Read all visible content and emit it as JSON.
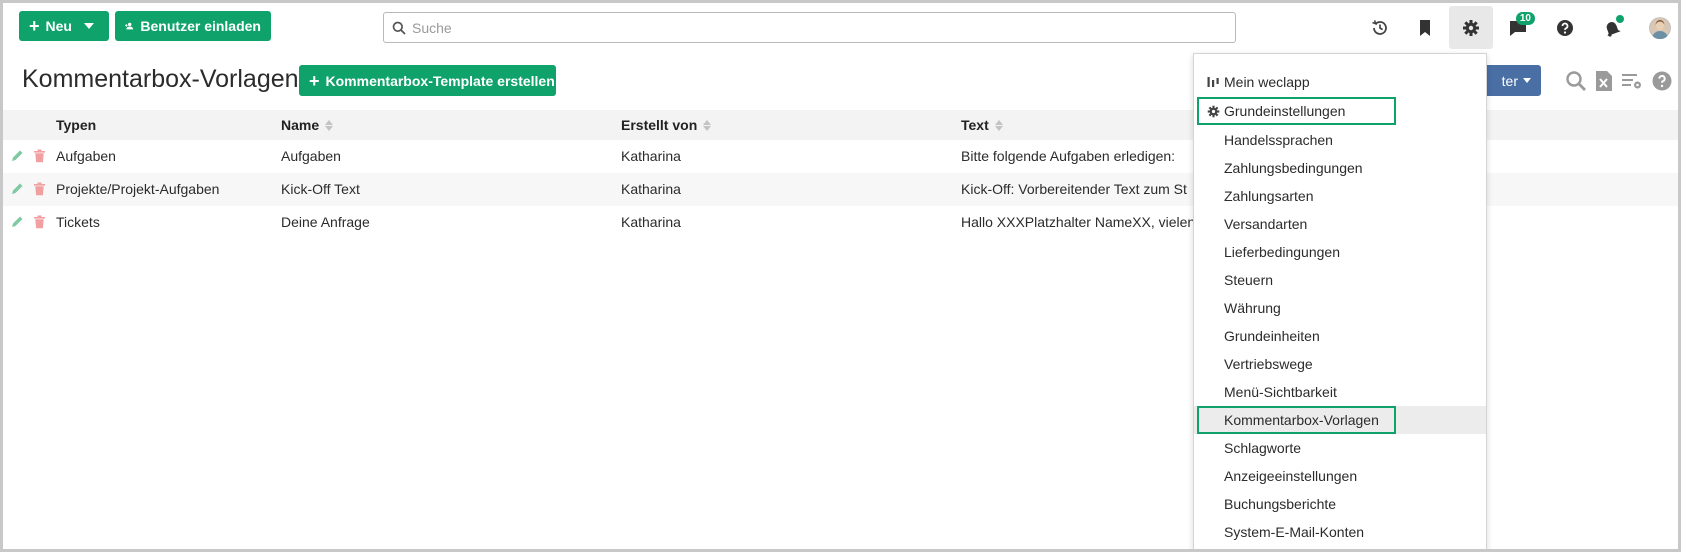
{
  "topbar": {
    "new_label": "Neu",
    "invite_label": "Benutzer einladen",
    "search_placeholder": "Suche",
    "messages_badge": "10"
  },
  "page": {
    "title": "Kommentarbox-Vorlagen",
    "create_button": "Kommentarbox-Template erstellen",
    "filter_label": "ter"
  },
  "table": {
    "columns": [
      "Typen",
      "Name",
      "Erstellt von",
      "Text"
    ],
    "rows": [
      {
        "typ": "Aufgaben",
        "name": "Aufgaben",
        "by": "Katharina",
        "text": "Bitte folgende Aufgaben erledigen:"
      },
      {
        "typ": "Projekte/Projekt-Aufgaben",
        "name": "Kick-Off Text",
        "by": "Katharina",
        "text": "Kick-Off: Vorbereitender Text zum St"
      },
      {
        "typ": "Tickets",
        "name": "Deine Anfrage",
        "by": "Katharina",
        "text": "Hallo XXXPlatzhalter NameXX, vielen"
      }
    ]
  },
  "settings_menu": {
    "items": [
      "Mein weclapp",
      "Grundeinstellungen",
      "Handelssprachen",
      "Zahlungsbedingungen",
      "Zahlungsarten",
      "Versandarten",
      "Lieferbedingungen",
      "Steuern",
      "Währung",
      "Grundeinheiten",
      "Vertriebswege",
      "Menü-Sichtbarkeit",
      "Kommentarbox-Vorlagen",
      "Schlagworte",
      "Anzeigeeinstellungen",
      "Buchungsberichte",
      "System-E-Mail-Konten"
    ]
  },
  "colors": {
    "brand_green": "#0fa36b",
    "filter_blue": "#4a6fa5",
    "edit_icon": "#7fc9a3",
    "delete_icon": "#f0a0a0"
  }
}
